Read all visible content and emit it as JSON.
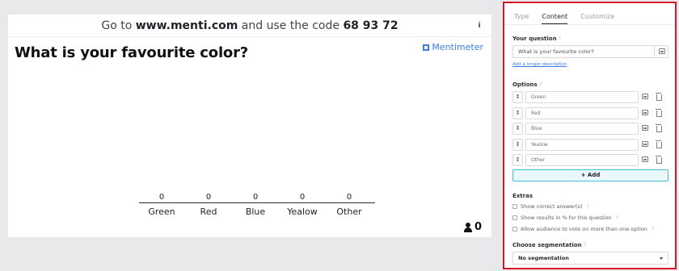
{
  "slide": {
    "code_prefix": "Go to ",
    "url": "www.menti.com",
    "code_mid": " and use the code ",
    "code": "68 93 72",
    "info_label": "i",
    "question": "What is your favourite color?",
    "brand": "Mentimeter",
    "voter_count": "0"
  },
  "chart_data": {
    "type": "bar",
    "categories": [
      "Green",
      "Red",
      "Blue",
      "Yealow",
      "Other"
    ],
    "values": [
      0,
      0,
      0,
      0,
      0
    ]
  },
  "panel": {
    "tabs": [
      {
        "label": "Type",
        "active": false
      },
      {
        "label": "Content",
        "active": true
      },
      {
        "label": "Customize",
        "active": false
      }
    ],
    "question_label": "Your question",
    "help_mark": "?",
    "question_value": "What is your favourite color?",
    "longer_description_link": "Add a longer description",
    "options_label": "Options",
    "options": [
      "Green",
      "Red",
      "Blue",
      "Yealow",
      "Other"
    ],
    "drag_handle_glyph": "↕",
    "add_label": "+ Add",
    "extras_label": "Extras",
    "extras": [
      {
        "label": "Show correct answer(s)",
        "checked": false
      },
      {
        "label": "Show results in % for this question",
        "checked": false
      },
      {
        "label": "Allow audience to vote on more than one option",
        "checked": false
      }
    ],
    "segmentation_label": "Choose segmentation",
    "segmentation_value": "No segmentation"
  },
  "colors": {
    "accent": "#3a7fe3",
    "highlight_border": "#d9152a",
    "add_button_border": "#3fc2d8"
  }
}
